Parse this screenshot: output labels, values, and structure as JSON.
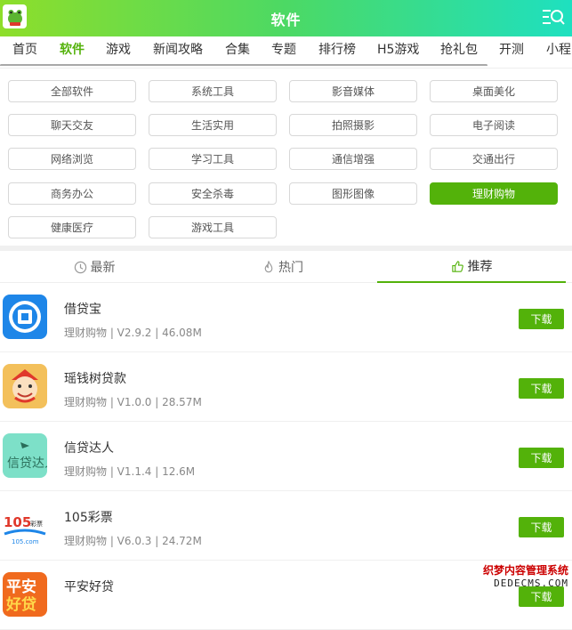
{
  "header": {
    "title": "软件"
  },
  "nav": {
    "items": [
      {
        "label": "首页",
        "active": false
      },
      {
        "label": "软件",
        "active": true
      },
      {
        "label": "游戏",
        "active": false
      },
      {
        "label": "新闻攻略",
        "active": false
      },
      {
        "label": "合集",
        "active": false
      },
      {
        "label": "专题",
        "active": false
      },
      {
        "label": "排行榜",
        "active": false
      },
      {
        "label": "H5游戏",
        "active": false
      },
      {
        "label": "抢礼包",
        "active": false
      },
      {
        "label": "开测",
        "active": false
      },
      {
        "label": "小程",
        "active": false
      }
    ]
  },
  "categories": [
    {
      "label": "全部软件",
      "active": false
    },
    {
      "label": "系统工具",
      "active": false
    },
    {
      "label": "影音媒体",
      "active": false
    },
    {
      "label": "桌面美化",
      "active": false
    },
    {
      "label": "聊天交友",
      "active": false
    },
    {
      "label": "生活实用",
      "active": false
    },
    {
      "label": "拍照摄影",
      "active": false
    },
    {
      "label": "电子阅读",
      "active": false
    },
    {
      "label": "网络浏览",
      "active": false
    },
    {
      "label": "学习工具",
      "active": false
    },
    {
      "label": "通信增强",
      "active": false
    },
    {
      "label": "交通出行",
      "active": false
    },
    {
      "label": "商务办公",
      "active": false
    },
    {
      "label": "安全杀毒",
      "active": false
    },
    {
      "label": "图形图像",
      "active": false
    },
    {
      "label": "理财购物",
      "active": true
    },
    {
      "label": "健康医疗",
      "active": false
    },
    {
      "label": "游戏工具",
      "active": false
    }
  ],
  "tabs": [
    {
      "label": "最新",
      "icon": "clock-icon",
      "active": false
    },
    {
      "label": "热门",
      "icon": "flame-icon",
      "active": false
    },
    {
      "label": "推荐",
      "icon": "thumbs-up-icon",
      "active": true
    }
  ],
  "apps": [
    {
      "name": "借贷宝",
      "meta": "理财购物 | V2.9.2 | 46.08M",
      "button": "下载"
    },
    {
      "name": "瑶钱树贷款",
      "meta": "理财购物 | V1.0.0 | 28.57M",
      "button": "下载"
    },
    {
      "name": "信贷达人",
      "meta": "理财购物 | V1.1.4 | 12.6M",
      "button": "下载"
    },
    {
      "name": "105彩票",
      "meta": "理财购物 | V6.0.3 | 24.72M",
      "button": "下载"
    },
    {
      "name": "平安好贷",
      "meta": "",
      "button": "下载"
    }
  ],
  "icon_text": {
    "app3": "信贷达人",
    "app4_num": "105",
    "app4_word": "彩票",
    "app4_site": "105.com",
    "app5_top": "平安",
    "app5_bot": "好贷"
  },
  "watermark": {
    "line1": "织梦内容管理系统",
    "line2": "DEDECMS.COM"
  },
  "colors": {
    "accent": "#53b20a",
    "header_start": "#8ede2a",
    "header_end": "#1ee0c0"
  }
}
